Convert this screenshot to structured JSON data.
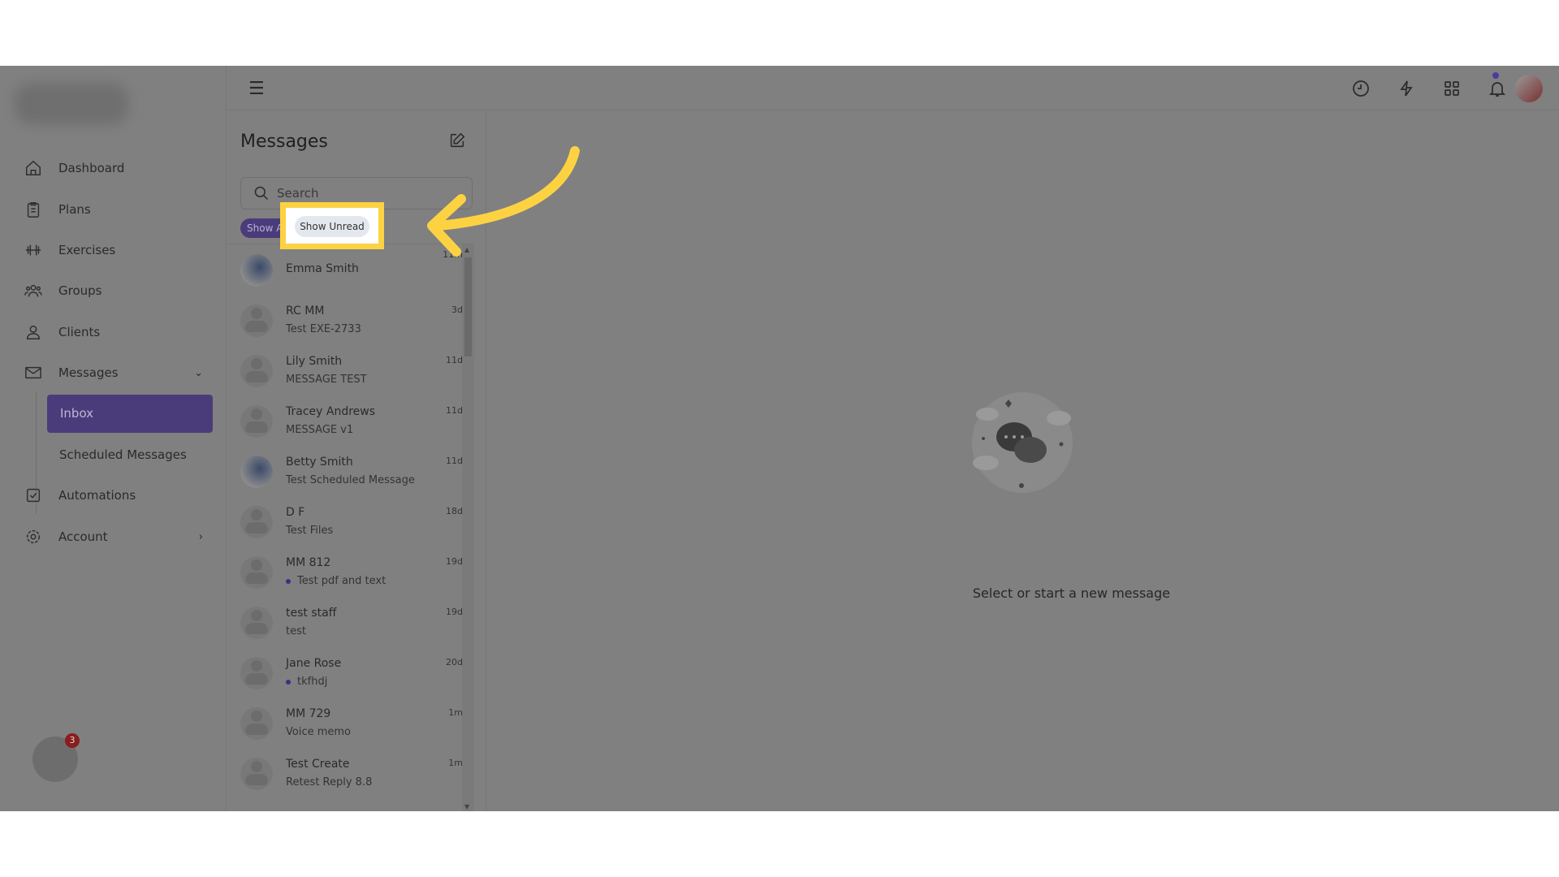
{
  "sidebar": {
    "items": [
      {
        "label": "Dashboard",
        "icon": "home-icon"
      },
      {
        "label": "Plans",
        "icon": "clipboard-icon"
      },
      {
        "label": "Exercises",
        "icon": "dumbbell-icon"
      },
      {
        "label": "Groups",
        "icon": "users-icon"
      },
      {
        "label": "Clients",
        "icon": "user-icon"
      },
      {
        "label": "Messages",
        "icon": "mail-icon"
      },
      {
        "label": "Automations",
        "icon": "checkbox-icon"
      },
      {
        "label": "Account",
        "icon": "gear-icon"
      }
    ],
    "sub_items": [
      "Inbox",
      "Scheduled Messages"
    ],
    "float_badge": "3"
  },
  "header": {
    "icons": [
      "clock-icon",
      "bolt-icon",
      "grid-icon",
      "bell-icon",
      "avatar"
    ]
  },
  "messages": {
    "title": "Messages",
    "search_placeholder": "Search",
    "filter_all": "Show All",
    "filter_unread": "Show Unread",
    "threads": [
      {
        "name": "Emma Smith",
        "preview": "",
        "time": "11m",
        "photo": true,
        "unread": false
      },
      {
        "name": "RC MM",
        "preview": "Test EXE-2733",
        "time": "3d",
        "photo": false,
        "unread": false
      },
      {
        "name": "Lily Smith",
        "preview": "MESSAGE TEST",
        "time": "11d",
        "photo": false,
        "unread": false
      },
      {
        "name": "Tracey Andrews",
        "preview": "MESSAGE v1",
        "time": "11d",
        "photo": false,
        "unread": false
      },
      {
        "name": "Betty Smith",
        "preview": "Test Scheduled Message",
        "time": "11d",
        "photo": true,
        "unread": false
      },
      {
        "name": "D F",
        "preview": "Test Files",
        "time": "18d",
        "photo": false,
        "unread": false
      },
      {
        "name": "MM 812",
        "preview": "Test pdf and text",
        "time": "19d",
        "photo": false,
        "unread": true
      },
      {
        "name": "test staff",
        "preview": "test",
        "time": "19d",
        "photo": false,
        "unread": false
      },
      {
        "name": "Jane Rose",
        "preview": "tkfhdj",
        "time": "20d",
        "photo": false,
        "unread": true
      },
      {
        "name": "MM 729",
        "preview": "Voice memo",
        "time": "1m",
        "photo": false,
        "unread": false
      },
      {
        "name": "Test Create",
        "preview": "Retest Reply 8.8",
        "time": "1m",
        "photo": false,
        "unread": false
      }
    ]
  },
  "empty_state": {
    "text": "Select or start a new message"
  },
  "colors": {
    "accent": "#5b4a9e",
    "highlight": "#fdd242",
    "overlay": "#808080"
  }
}
